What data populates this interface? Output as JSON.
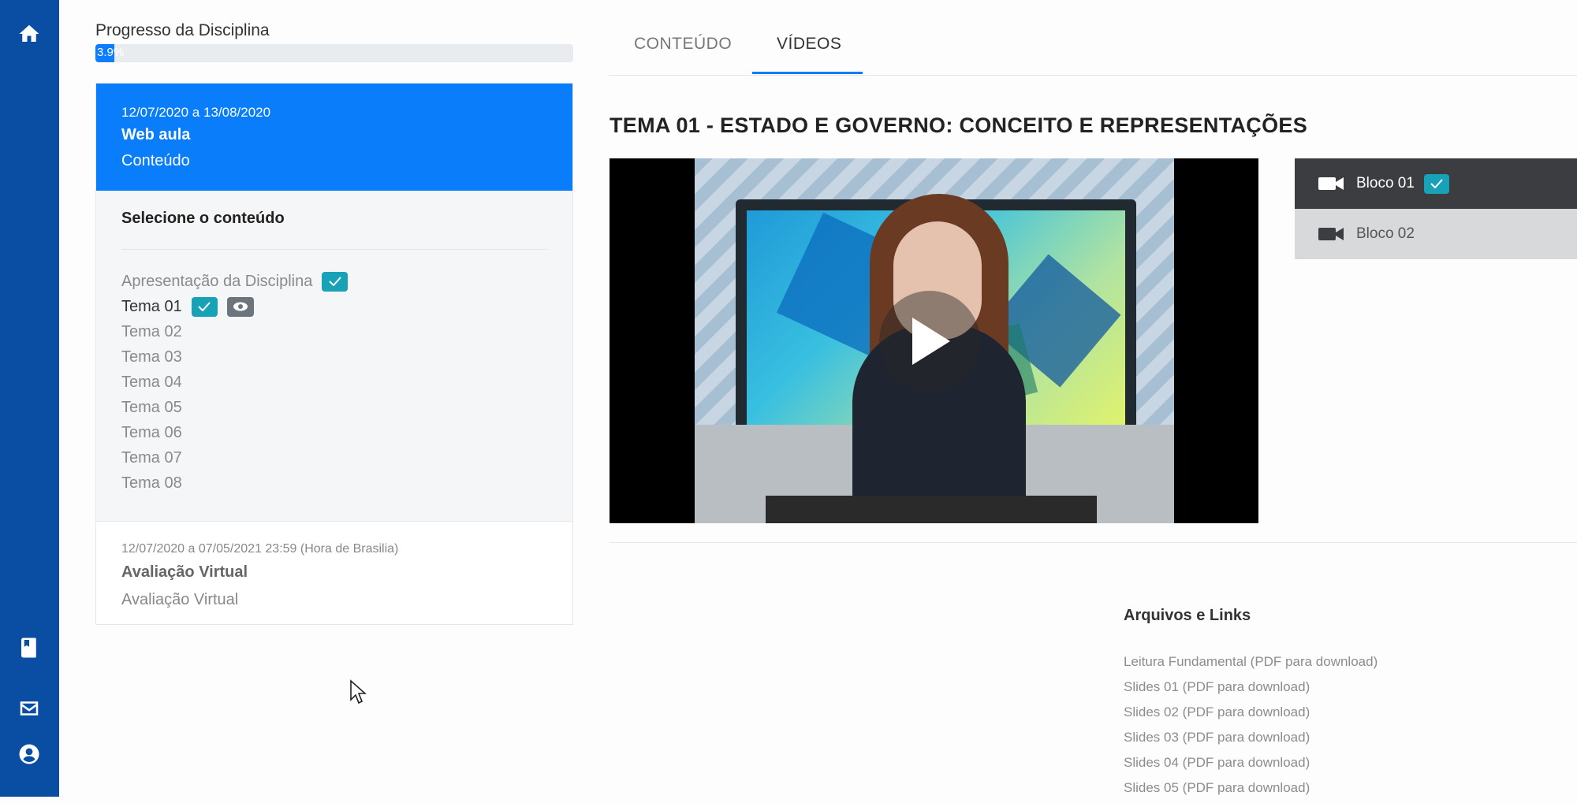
{
  "sidebar": {
    "icons": [
      "home-icon",
      "book-icon",
      "mail-icon",
      "user-circle-icon"
    ]
  },
  "progress": {
    "label": "Progresso da Disciplina",
    "value_text": "3.9%",
    "percent": 3.9
  },
  "course_panel": {
    "web_aula": {
      "date": "12/07/2020 a 13/08/2020",
      "title": "Web aula",
      "subtitle": "Conteúdo"
    },
    "select_title": "Selecione o conteúdo",
    "topics": [
      {
        "label": "Apresentação da Disciplina",
        "checked": true,
        "viewing": false
      },
      {
        "label": "Tema 01",
        "checked": true,
        "viewing": true
      },
      {
        "label": "Tema 02",
        "checked": false,
        "viewing": false
      },
      {
        "label": "Tema 03",
        "checked": false,
        "viewing": false
      },
      {
        "label": "Tema 04",
        "checked": false,
        "viewing": false
      },
      {
        "label": "Tema 05",
        "checked": false,
        "viewing": false
      },
      {
        "label": "Tema 06",
        "checked": false,
        "viewing": false
      },
      {
        "label": "Tema 07",
        "checked": false,
        "viewing": false
      },
      {
        "label": "Tema 08",
        "checked": false,
        "viewing": false
      }
    ],
    "evaluation": {
      "date": "12/07/2020 a 07/05/2021 23:59 (Hora de Brasilia)",
      "title": "Avaliação Virtual",
      "subtitle": "Avaliação Virtual"
    }
  },
  "tabs": {
    "content": "CONTEÚDO",
    "videos": "VÍDEOS",
    "active": "videos"
  },
  "theme_title": "TEMA 01 - ESTADO E GOVERNO: CONCEITO E REPRESENTAÇÕES",
  "video_blocks": [
    {
      "label": "Bloco 01",
      "checked": true,
      "selected": true
    },
    {
      "label": "Bloco 02",
      "checked": false,
      "selected": false
    }
  ],
  "files": {
    "title": "Arquivos e Links",
    "items": [
      "Leitura Fundamental (PDF para download)",
      "Slides 01 (PDF para download)",
      "Slides 02 (PDF para download)",
      "Slides 03 (PDF para download)",
      "Slides 04 (PDF para download)",
      "Slides 05 (PDF para download)"
    ]
  },
  "colors": {
    "rail": "#0a4ea3",
    "accent": "#0a7dfb",
    "check_badge": "#17a2b8",
    "eye_badge": "#6c757d"
  }
}
